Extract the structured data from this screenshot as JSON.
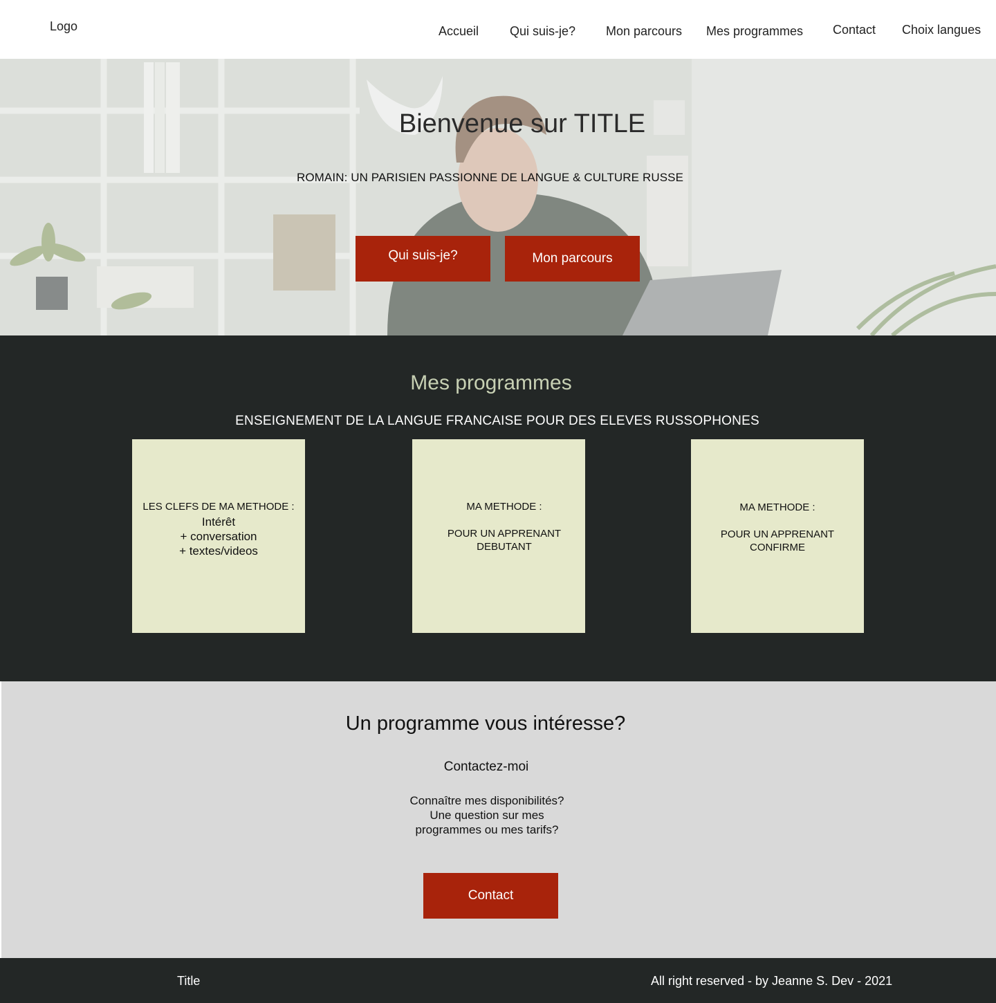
{
  "header": {
    "logo": "Logo",
    "nav": [
      {
        "label": "Accueil"
      },
      {
        "label": "Qui suis-je?"
      },
      {
        "label": "Mon parcours"
      },
      {
        "label": "Mes programmes"
      },
      {
        "label": "Contact"
      },
      {
        "label": "Choix langues"
      }
    ]
  },
  "hero": {
    "title": "Bienvenue sur TITLE",
    "subtitle": "ROMAIN: UN PARISIEN PASSIONNE DE LANGUE & CULTURE RUSSE",
    "buttons": [
      {
        "label": "Qui suis-je?"
      },
      {
        "label": "Mon parcours"
      }
    ]
  },
  "programs": {
    "title": "Mes programmes",
    "subtitle": "ENSEIGNEMENT DE LA LANGUE FRANCAISE POUR DES ELEVES RUSSOPHONES",
    "cards": [
      {
        "heading": "LES CLEFS DE MA METHODE :",
        "lines": [
          "Intérêt",
          "+ conversation",
          "+ textes/videos"
        ]
      },
      {
        "heading": "MA METHODE :",
        "lines": [
          "POUR UN  APPRENANT",
          "DEBUTANT"
        ]
      },
      {
        "heading": "MA METHODE :",
        "lines": [
          "POUR UN  APPRENANT",
          "CONFIRME"
        ]
      }
    ]
  },
  "contact": {
    "title": "Un programme vous intéresse?",
    "subtitle": "Contactez-moi",
    "questions": [
      "Connaître mes disponibilités?",
      "Une question sur mes",
      "programmes ou mes tarifs?"
    ],
    "button": "Contact"
  },
  "footer": {
    "title": "Title",
    "copyright": "All right reserved - by Jeanne S. Dev - 2021"
  },
  "colors": {
    "accent": "#a8230b",
    "dark": "#232726",
    "card": "#e6e9cb",
    "programs_title": "#c7d0b3",
    "contact_bg": "#d9d9d9"
  }
}
